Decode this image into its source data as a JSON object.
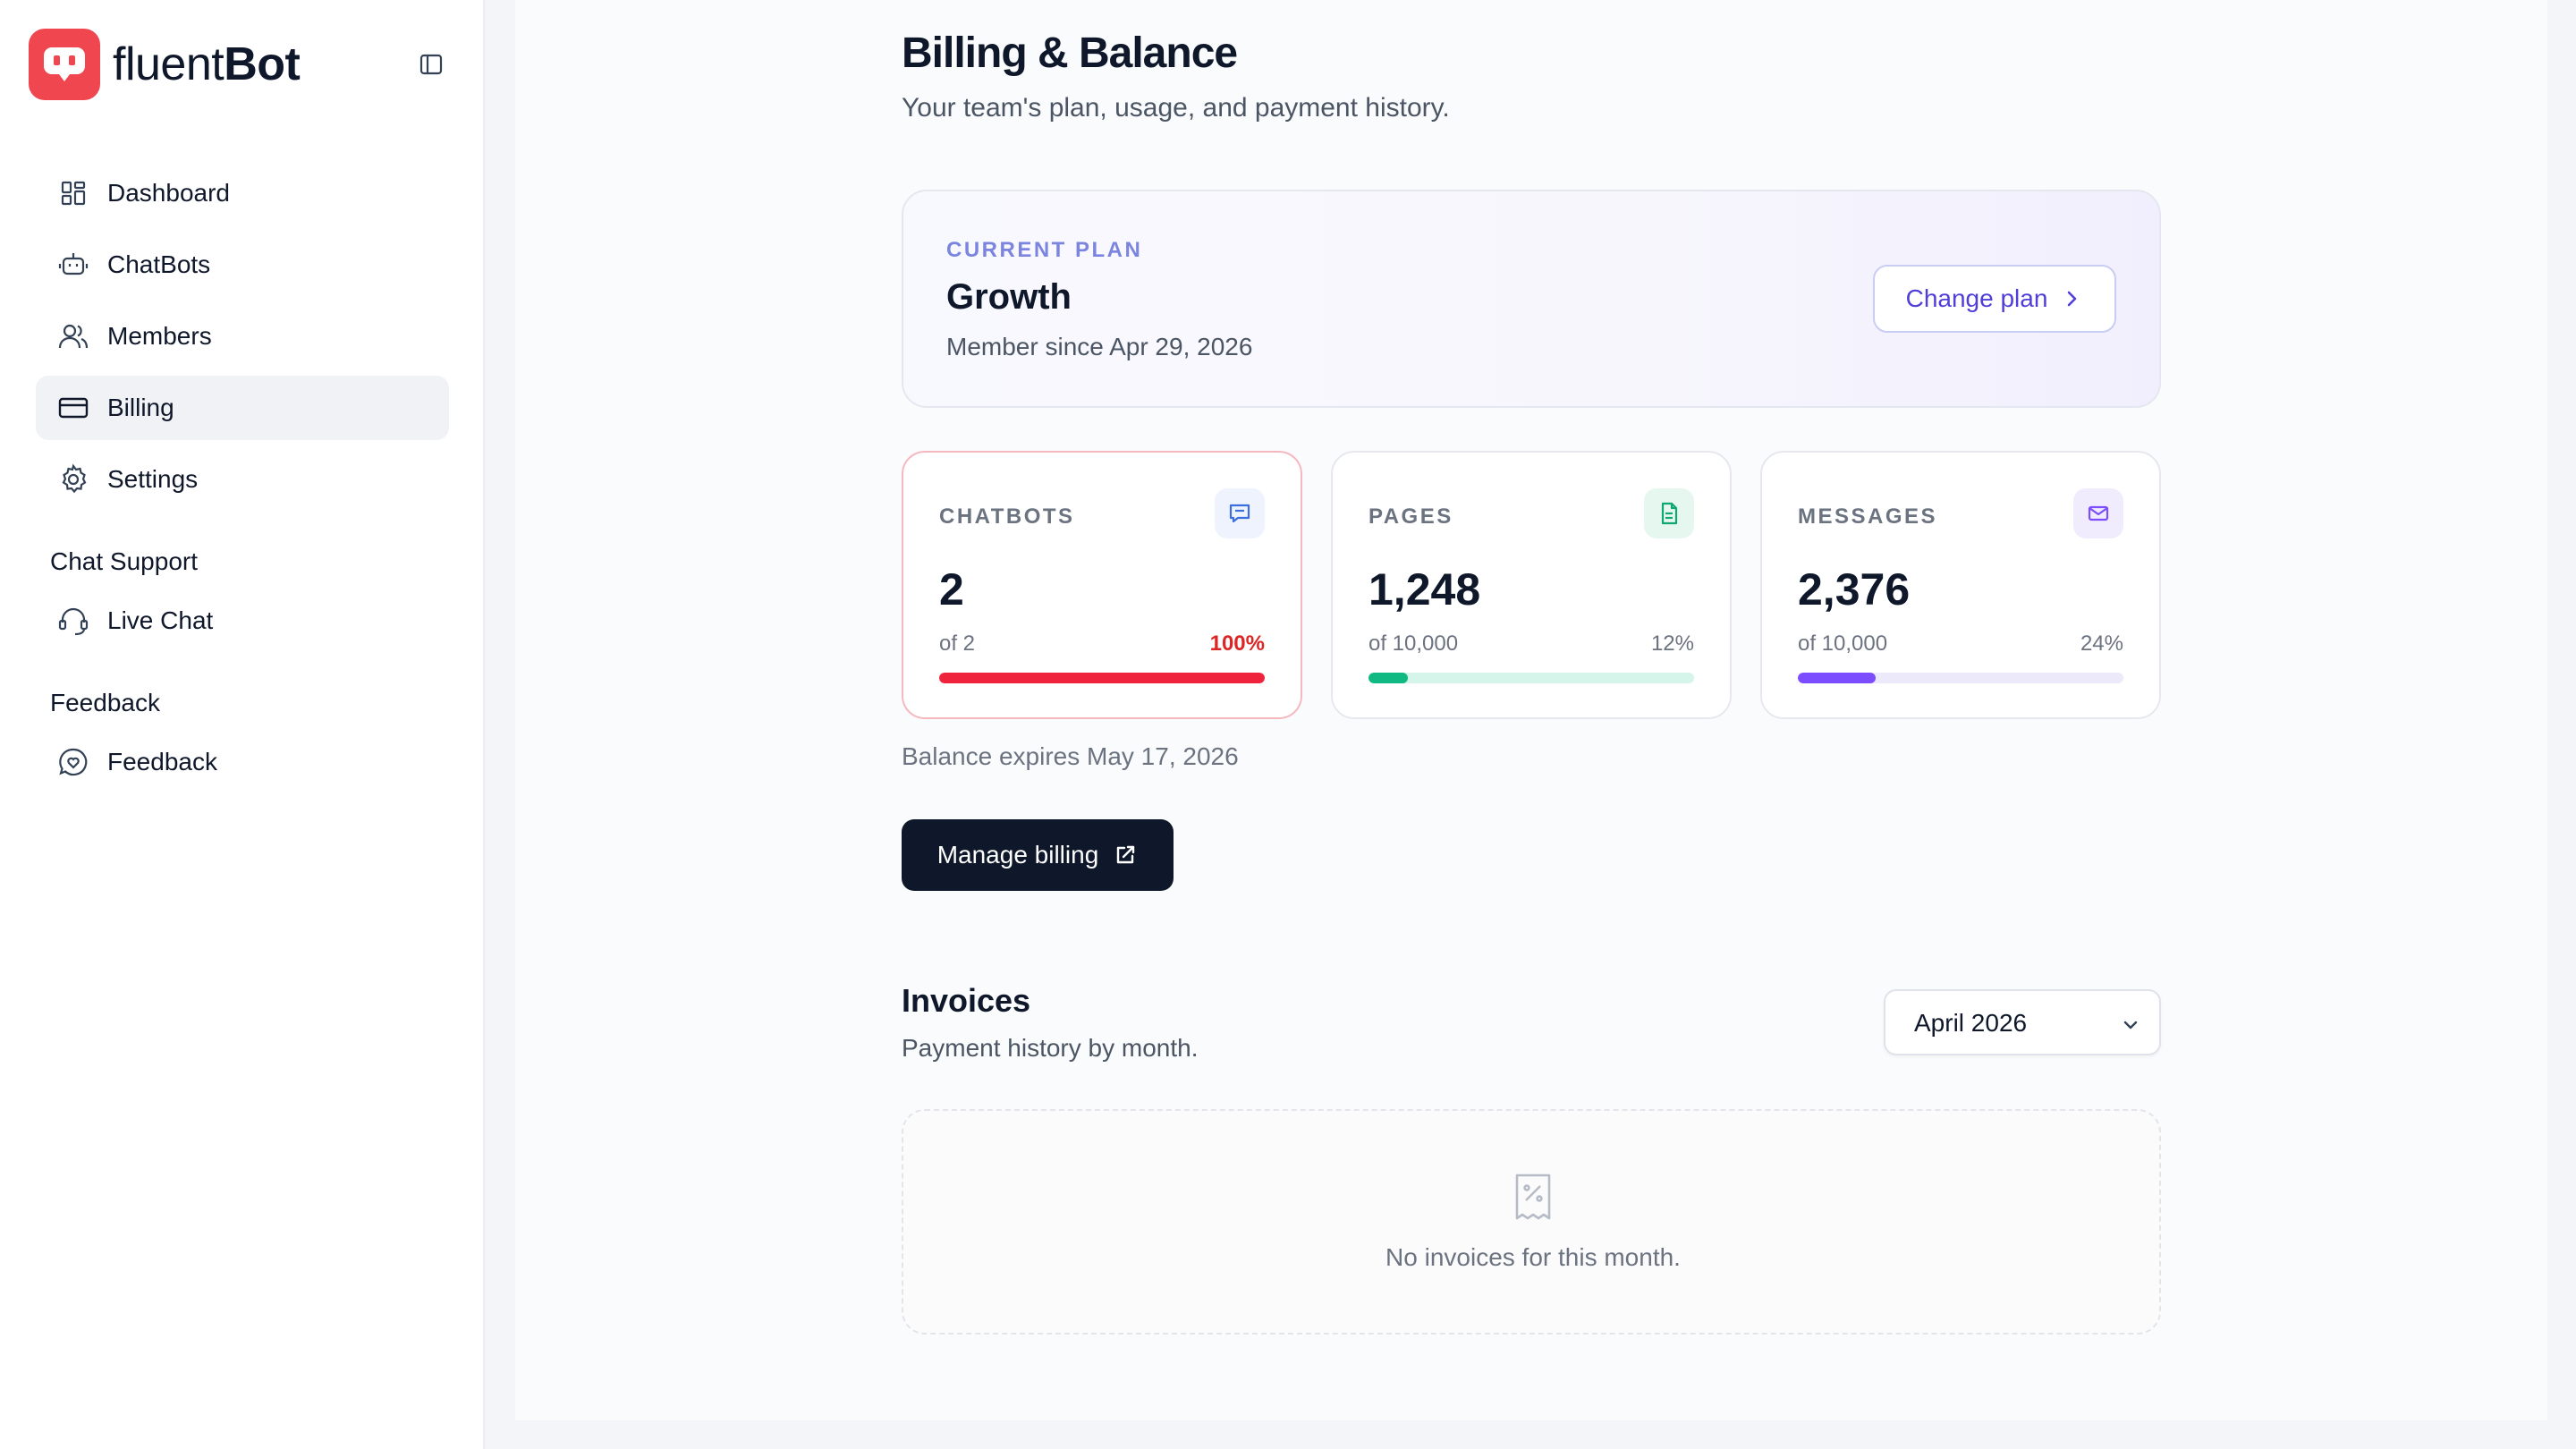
{
  "brand": {
    "name_light": "fluent",
    "name_bold": "Bot",
    "accent": "#f0464f"
  },
  "sidebar": {
    "items": [
      {
        "label": "Dashboard",
        "icon": "dashboard-icon"
      },
      {
        "label": "ChatBots",
        "icon": "robot-icon"
      },
      {
        "label": "Members",
        "icon": "users-icon"
      },
      {
        "label": "Billing",
        "icon": "credit-card-icon",
        "active": true
      },
      {
        "label": "Settings",
        "icon": "gear-icon"
      }
    ],
    "sections": [
      {
        "title": "Chat Support",
        "items": [
          {
            "label": "Live Chat",
            "icon": "headset-icon"
          }
        ]
      },
      {
        "title": "Feedback",
        "items": [
          {
            "label": "Feedback",
            "icon": "message-heart-icon"
          }
        ]
      }
    ]
  },
  "page": {
    "title": "Billing & Balance",
    "subtitle": "Your team's plan, usage, and payment history."
  },
  "plan": {
    "eyebrow": "CURRENT PLAN",
    "name": "Growth",
    "since": "Member since Apr 29, 2026",
    "change_label": "Change plan"
  },
  "usage": [
    {
      "label": "CHATBOTS",
      "value": "2",
      "of": "of 2",
      "pct": "100%",
      "fraction": 1.0,
      "color": "#ef233c",
      "track": "#fde2e4",
      "icon": "chat-icon",
      "icon_bg": "#eef3fd",
      "icon_color": "#3b6fe0"
    },
    {
      "label": "PAGES",
      "value": "1,248",
      "of": "of 10,000",
      "pct": "12%",
      "fraction": 0.12,
      "color": "#10b981",
      "track": "#d6f5ea",
      "icon": "document-icon",
      "icon_bg": "#e6f7f0",
      "icon_color": "#10a872"
    },
    {
      "label": "MESSAGES",
      "value": "2,376",
      "of": "of 10,000",
      "pct": "24%",
      "fraction": 0.24,
      "color": "#7c4dff",
      "track": "#ece9fb",
      "icon": "mail-icon",
      "icon_bg": "#f1ecfd",
      "icon_color": "#7c4dff"
    }
  ],
  "balance_expires": "Balance expires May 17, 2026",
  "manage_billing_label": "Manage billing",
  "invoices": {
    "title": "Invoices",
    "subtitle": "Payment history by month.",
    "selected_month": "April 2026",
    "empty_text": "No invoices for this month."
  }
}
